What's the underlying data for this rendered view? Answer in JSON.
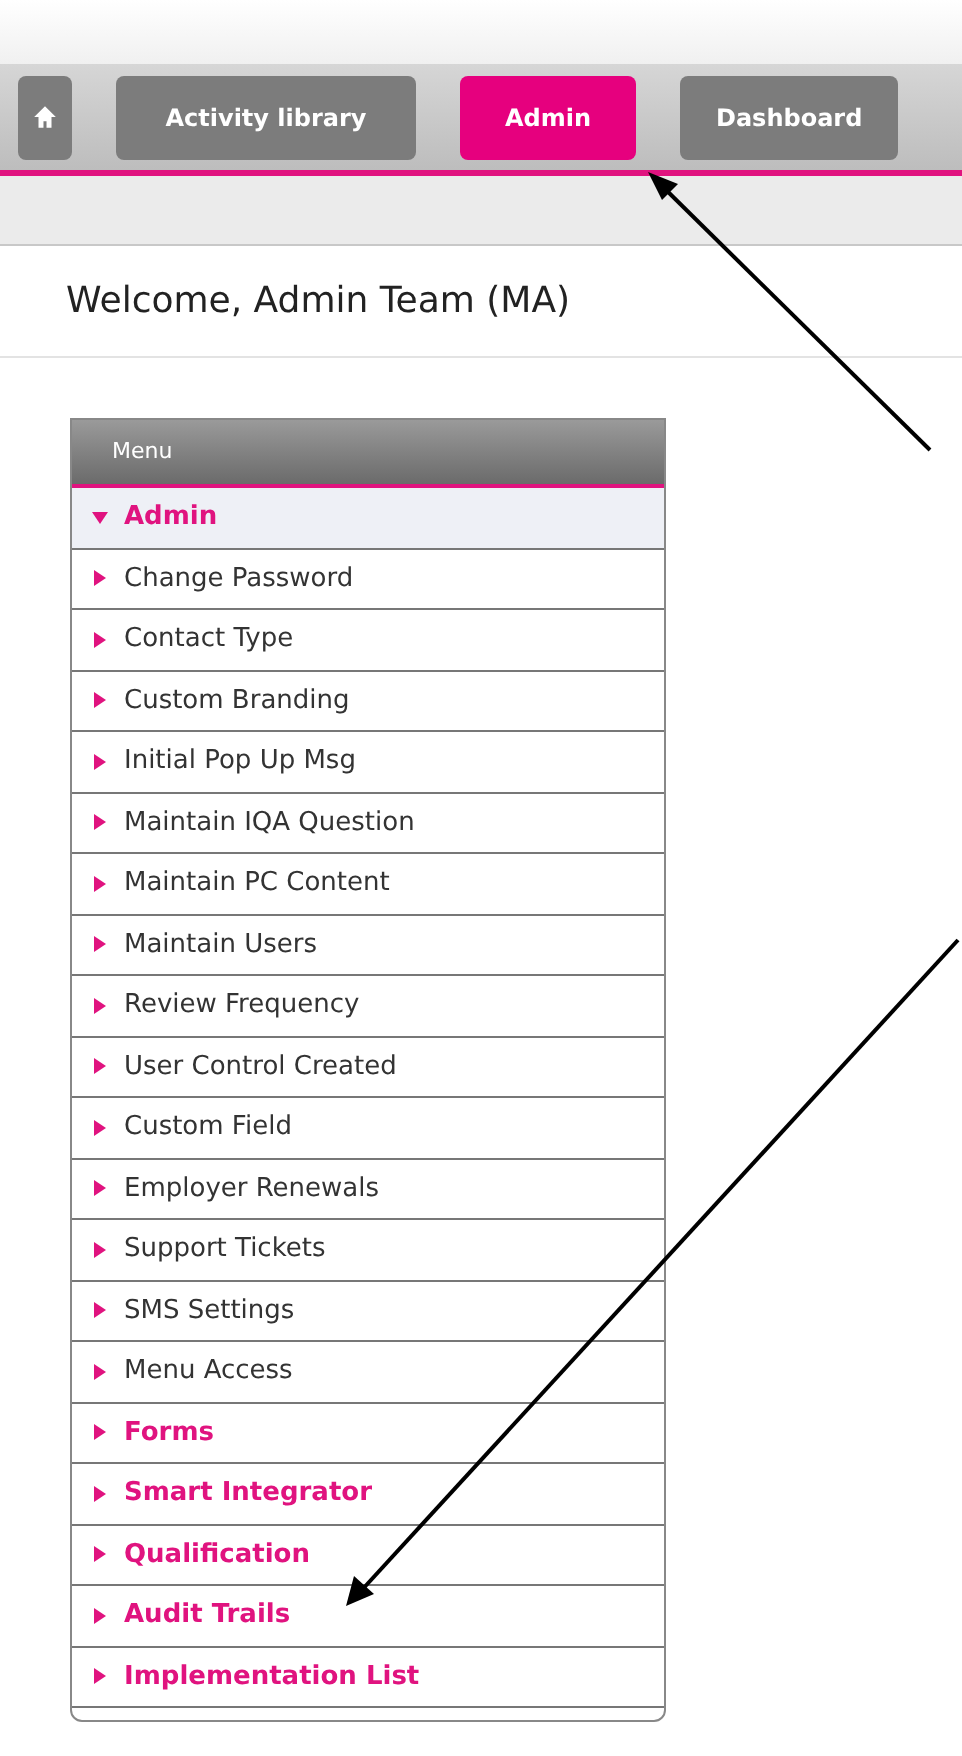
{
  "nav": {
    "tabs": [
      {
        "kind": "home",
        "selected": false
      },
      {
        "kind": "text",
        "label": "Activity library",
        "selected": false
      },
      {
        "kind": "text",
        "label": "Admin",
        "selected": true
      },
      {
        "kind": "text",
        "label": "Dashboard",
        "selected": false
      }
    ]
  },
  "welcome": "Welcome, Admin Team (MA)",
  "menu": {
    "title": "Menu",
    "sections": [
      {
        "label": "Admin",
        "expanded": true,
        "children": [
          {
            "label": "Change Password"
          },
          {
            "label": "Contact Type"
          },
          {
            "label": "Custom Branding"
          },
          {
            "label": "Initial Pop Up Msg"
          },
          {
            "label": "Maintain IQA Question"
          },
          {
            "label": "Maintain PC Content"
          },
          {
            "label": "Maintain Users"
          },
          {
            "label": "Review Frequency"
          },
          {
            "label": "User Control Created"
          },
          {
            "label": "Custom Field"
          },
          {
            "label": "Employer Renewals"
          },
          {
            "label": "Support Tickets"
          },
          {
            "label": "SMS Settings"
          },
          {
            "label": "Menu Access"
          }
        ]
      },
      {
        "label": "Forms",
        "expanded": false
      },
      {
        "label": "Smart Integrator",
        "expanded": false
      },
      {
        "label": "Qualification",
        "expanded": false
      },
      {
        "label": "Audit Trails",
        "expanded": false
      },
      {
        "label": "Implementation List",
        "expanded": false
      }
    ]
  }
}
